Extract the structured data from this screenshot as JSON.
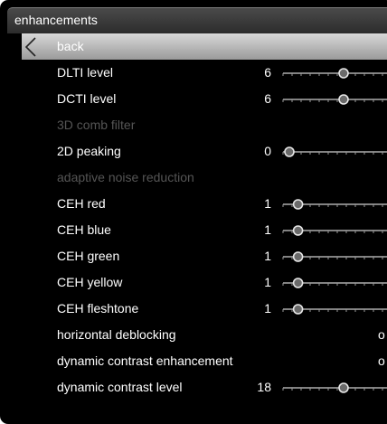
{
  "menu": {
    "title": "enhancements",
    "back_label": "back",
    "items": [
      {
        "label": "DLTI level",
        "value": "6",
        "knob": 0.5,
        "disabled": false
      },
      {
        "label": "DCTI level",
        "value": "6",
        "knob": 0.5,
        "disabled": false
      },
      {
        "label": "3D comb filter",
        "disabled": true
      },
      {
        "label": "2D peaking",
        "value": "0",
        "knob": 0.0,
        "disabled": false
      },
      {
        "label": "adaptive noise reduction",
        "disabled": true
      },
      {
        "label": "CEH red",
        "value": "1",
        "knob": 0.08,
        "disabled": false
      },
      {
        "label": "CEH blue",
        "value": "1",
        "knob": 0.08,
        "disabled": false
      },
      {
        "label": "CEH green",
        "value": "1",
        "knob": 0.08,
        "disabled": false
      },
      {
        "label": "CEH yellow",
        "value": "1",
        "knob": 0.08,
        "disabled": false
      },
      {
        "label": "CEH fleshtone",
        "value": "1",
        "knob": 0.08,
        "disabled": false
      },
      {
        "label": "horizontal deblocking",
        "text_value": "o",
        "disabled": false
      },
      {
        "label": "dynamic contrast enhancement",
        "text_value": "o",
        "disabled": false
      },
      {
        "label": "dynamic contrast level",
        "value": "18",
        "knob": 0.5,
        "disabled": false
      }
    ]
  }
}
